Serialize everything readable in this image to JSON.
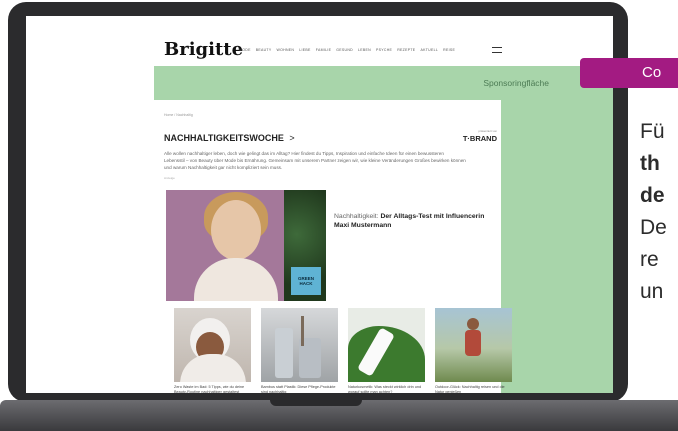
{
  "site": {
    "logo": "Brigitte",
    "nav": [
      "MODE",
      "BEAUTY",
      "WOHNEN",
      "LIEBE",
      "FAMILIE",
      "GESUND",
      "LEBEN",
      "PSYCHE",
      "REZEPTE",
      "AKTUELL",
      "REISE"
    ],
    "sponsor_label": "Sponsoringfläche",
    "breadcrumb": "Home / Nachhaltig",
    "section_title": "NACHHALTIGKEITSWOCHE",
    "section_chevron": ">",
    "brand_small": "präsentiert von",
    "brand": "T·BRAND",
    "intro_lines": [
      "Alle wollen nachhaltiger leben, doch wie gelingt das im Alltag? Hier findest du Tipps, Inspiration und einfache Ideen für einen bewussteren",
      "Lebensstil – von Beauty über Mode bis Ernährung. Gemeinsam mit unserem Partner zeigen wir, wie kleine Veränderungen Großes bewirken können",
      "und warum Nachhaltigkeit gar nicht kompliziert sein muss."
    ],
    "tiny_tag": "Anzeige",
    "hero": {
      "badge": "GREEN HACK",
      "kicker": "Nachhaltigkeit: ",
      "headline": "Der Alltags-Test mit Influencerin Maxi Mustermann"
    },
    "tiles": [
      {
        "caption": "Zero Waste im Bad: 5 Tipps, wie du deine Beauty-Routine nachhaltiger gestaltest"
      },
      {
        "caption": "Bambus statt Plastik: Diese Pflege-Produkte sind nachhaltig"
      },
      {
        "caption": "Naturkosmetik: Was steckt wirklich drin und worauf sollte man achten?"
      },
      {
        "caption": "Outdoor-Glück: Nachhaltig reisen und die Natur genießen"
      }
    ]
  },
  "side": {
    "tag": "Co",
    "lines": [
      "Fü",
      "th",
      "de",
      "De",
      "re",
      "un"
    ]
  },
  "colors": {
    "sponsor_green": "#a8d5aa",
    "tag_magenta": "#a31b82",
    "hero_pink": "#a4789a",
    "badge_blue": "#5fb3d4"
  }
}
